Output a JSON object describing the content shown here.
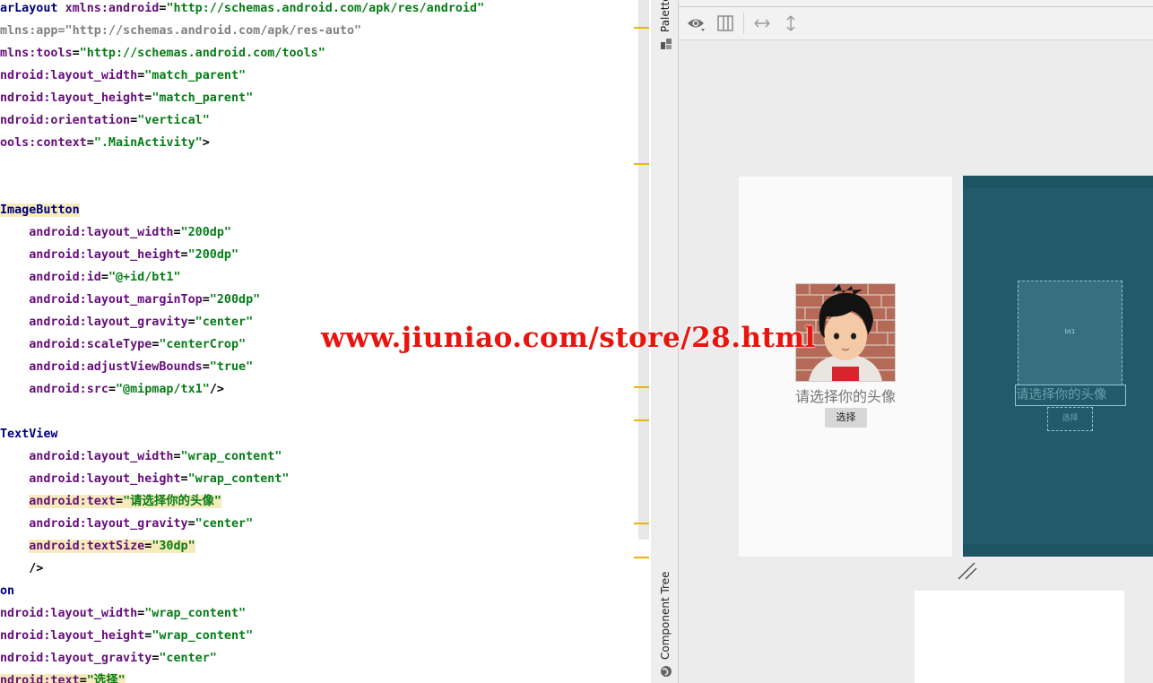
{
  "editor": {
    "lines": [
      [
        {
          "t": "arLayout ",
          "c": "tag"
        },
        {
          "t": "xmlns:android",
          "c": "attr"
        },
        {
          "t": "=",
          "c": "plain"
        },
        {
          "t": "\"http://schemas.android.com/apk/res/android\"",
          "c": "aval"
        }
      ],
      [
        {
          "t": "mlns:app=\"http://schemas.android.com/apk/res-auto\"",
          "c": "gray"
        }
      ],
      [
        {
          "t": "mlns:tools",
          "c": "attr"
        },
        {
          "t": "=",
          "c": "plain"
        },
        {
          "t": "\"http://schemas.android.com/tools\"",
          "c": "aval"
        }
      ],
      [
        {
          "t": "ndroid:layout_width",
          "c": "attr"
        },
        {
          "t": "=",
          "c": "plain"
        },
        {
          "t": "\"match_parent\"",
          "c": "aval"
        }
      ],
      [
        {
          "t": "ndroid:layout_height",
          "c": "attr"
        },
        {
          "t": "=",
          "c": "plain"
        },
        {
          "t": "\"match_parent\"",
          "c": "aval"
        }
      ],
      [
        {
          "t": "ndroid:orientation",
          "c": "attr"
        },
        {
          "t": "=",
          "c": "plain"
        },
        {
          "t": "\"vertical\"",
          "c": "aval"
        }
      ],
      [
        {
          "t": "ools:context",
          "c": "attr"
        },
        {
          "t": "=",
          "c": "plain"
        },
        {
          "t": "\".MainActivity\"",
          "c": "aval"
        },
        {
          "t": ">",
          "c": "plain"
        }
      ],
      [],
      [],
      [
        {
          "t": "ImageButton",
          "c": "tag",
          "h": true
        }
      ],
      [
        {
          "t": "    android:layout_width",
          "c": "attr"
        },
        {
          "t": "=",
          "c": "plain"
        },
        {
          "t": "\"200dp\"",
          "c": "aval"
        }
      ],
      [
        {
          "t": "    android:layout_height",
          "c": "attr"
        },
        {
          "t": "=",
          "c": "plain"
        },
        {
          "t": "\"200dp\"",
          "c": "aval"
        }
      ],
      [
        {
          "t": "    android:id",
          "c": "attr"
        },
        {
          "t": "=",
          "c": "plain"
        },
        {
          "t": "\"@+id/bt1\"",
          "c": "aval"
        }
      ],
      [
        {
          "t": "    android:layout_marginTop",
          "c": "attr"
        },
        {
          "t": "=",
          "c": "plain"
        },
        {
          "t": "\"200dp\"",
          "c": "aval"
        }
      ],
      [
        {
          "t": "    android:layout_gravity",
          "c": "attr"
        },
        {
          "t": "=",
          "c": "plain"
        },
        {
          "t": "\"center\"",
          "c": "aval"
        }
      ],
      [
        {
          "t": "    android:scaleType",
          "c": "attr"
        },
        {
          "t": "=",
          "c": "plain"
        },
        {
          "t": "\"centerCrop\"",
          "c": "aval"
        }
      ],
      [
        {
          "t": "    android:adjustViewBounds",
          "c": "attr"
        },
        {
          "t": "=",
          "c": "plain"
        },
        {
          "t": "\"true\"",
          "c": "aval"
        }
      ],
      [
        {
          "t": "    android:src",
          "c": "attr"
        },
        {
          "t": "=",
          "c": "plain"
        },
        {
          "t": "\"@mipmap/tx1\"",
          "c": "aval"
        },
        {
          "t": "/>",
          "c": "plain"
        }
      ],
      [],
      [
        {
          "t": "TextView",
          "c": "tag"
        }
      ],
      [
        {
          "t": "    android:layout_width",
          "c": "attr"
        },
        {
          "t": "=",
          "c": "plain"
        },
        {
          "t": "\"wrap_content\"",
          "c": "aval"
        }
      ],
      [
        {
          "t": "    android:layout_height",
          "c": "attr"
        },
        {
          "t": "=",
          "c": "plain"
        },
        {
          "t": "\"wrap_content\"",
          "c": "aval"
        }
      ],
      [
        {
          "t": "    ",
          "c": "plain"
        },
        {
          "t": "android:text",
          "c": "attr",
          "h": true
        },
        {
          "t": "=",
          "c": "plain",
          "h": true
        },
        {
          "t": "\"请选择你的头像\"",
          "c": "aval",
          "h": true
        }
      ],
      [
        {
          "t": "    android:layout_gravity",
          "c": "attr"
        },
        {
          "t": "=",
          "c": "plain"
        },
        {
          "t": "\"center\"",
          "c": "aval"
        }
      ],
      [
        {
          "t": "    ",
          "c": "plain"
        },
        {
          "t": "android:textSize",
          "c": "attr",
          "h": true
        },
        {
          "t": "=",
          "c": "plain",
          "h": true
        },
        {
          "t": "\"30dp\"",
          "c": "aval",
          "h": true
        }
      ],
      [
        {
          "t": "    />",
          "c": "plain"
        }
      ],
      [
        {
          "t": "on",
          "c": "tag"
        }
      ],
      [
        {
          "t": "ndroid:layout_width",
          "c": "attr"
        },
        {
          "t": "=",
          "c": "plain"
        },
        {
          "t": "\"wrap_content\"",
          "c": "aval"
        }
      ],
      [
        {
          "t": "ndroid:layout_height",
          "c": "attr"
        },
        {
          "t": "=",
          "c": "plain"
        },
        {
          "t": "\"wrap_content\"",
          "c": "aval"
        }
      ],
      [
        {
          "t": "ndroid:layout_gravity",
          "c": "attr"
        },
        {
          "t": "=",
          "c": "plain"
        },
        {
          "t": "\"center\"",
          "c": "aval"
        }
      ],
      [
        {
          "t": "ndroid:text",
          "c": "attr",
          "h": true
        },
        {
          "t": "=",
          "c": "plain",
          "h": true
        },
        {
          "t": "\"选择\"",
          "c": "aval",
          "h": true
        }
      ]
    ]
  },
  "side_strip": {
    "palette_label": "Palette",
    "component_tree_label": "Component Tree"
  },
  "toolbar": {
    "icons": [
      "eye-icon",
      "columns-icon",
      "horizontal-resize-icon",
      "vertical-resize-icon"
    ]
  },
  "preview": {
    "prompt_text": "请选择你的头像",
    "button_label": "选择"
  },
  "blueprint": {
    "image_button_label": "bt1",
    "prompt_text": "请选择你的头像",
    "button_label": "选择"
  },
  "watermark": "www.jiuniao.com/store/28.html",
  "colors": {
    "blueprint_bg": "#215a6a",
    "marker": "#e5b70f",
    "watermark": "#e8150f"
  }
}
